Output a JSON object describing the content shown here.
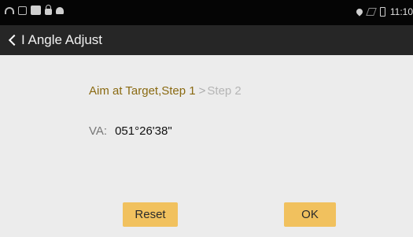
{
  "status_bar": {
    "time": "11:10",
    "icons_left": [
      "wifi-icon",
      "image-icon",
      "square-icon",
      "lock-icon",
      "android-icon"
    ],
    "icons_right": [
      "location-icon",
      "no-signal-icon",
      "battery-icon"
    ]
  },
  "toolbar": {
    "title": "I Angle Adjust",
    "back_icon": "chevron-left-icon"
  },
  "steps": {
    "active": "Aim at Target,Step 1",
    "separator": ">",
    "inactive": "Step 2"
  },
  "reading": {
    "label": "VA:",
    "value": "051°26'38\""
  },
  "buttons": {
    "reset": "Reset",
    "ok": "OK"
  },
  "colors": {
    "accent": "#f1c15e",
    "step_active": "#8a6a12",
    "toolbar_bg": "#262626",
    "statusbar_bg": "#050505",
    "content_bg": "#ececec"
  }
}
